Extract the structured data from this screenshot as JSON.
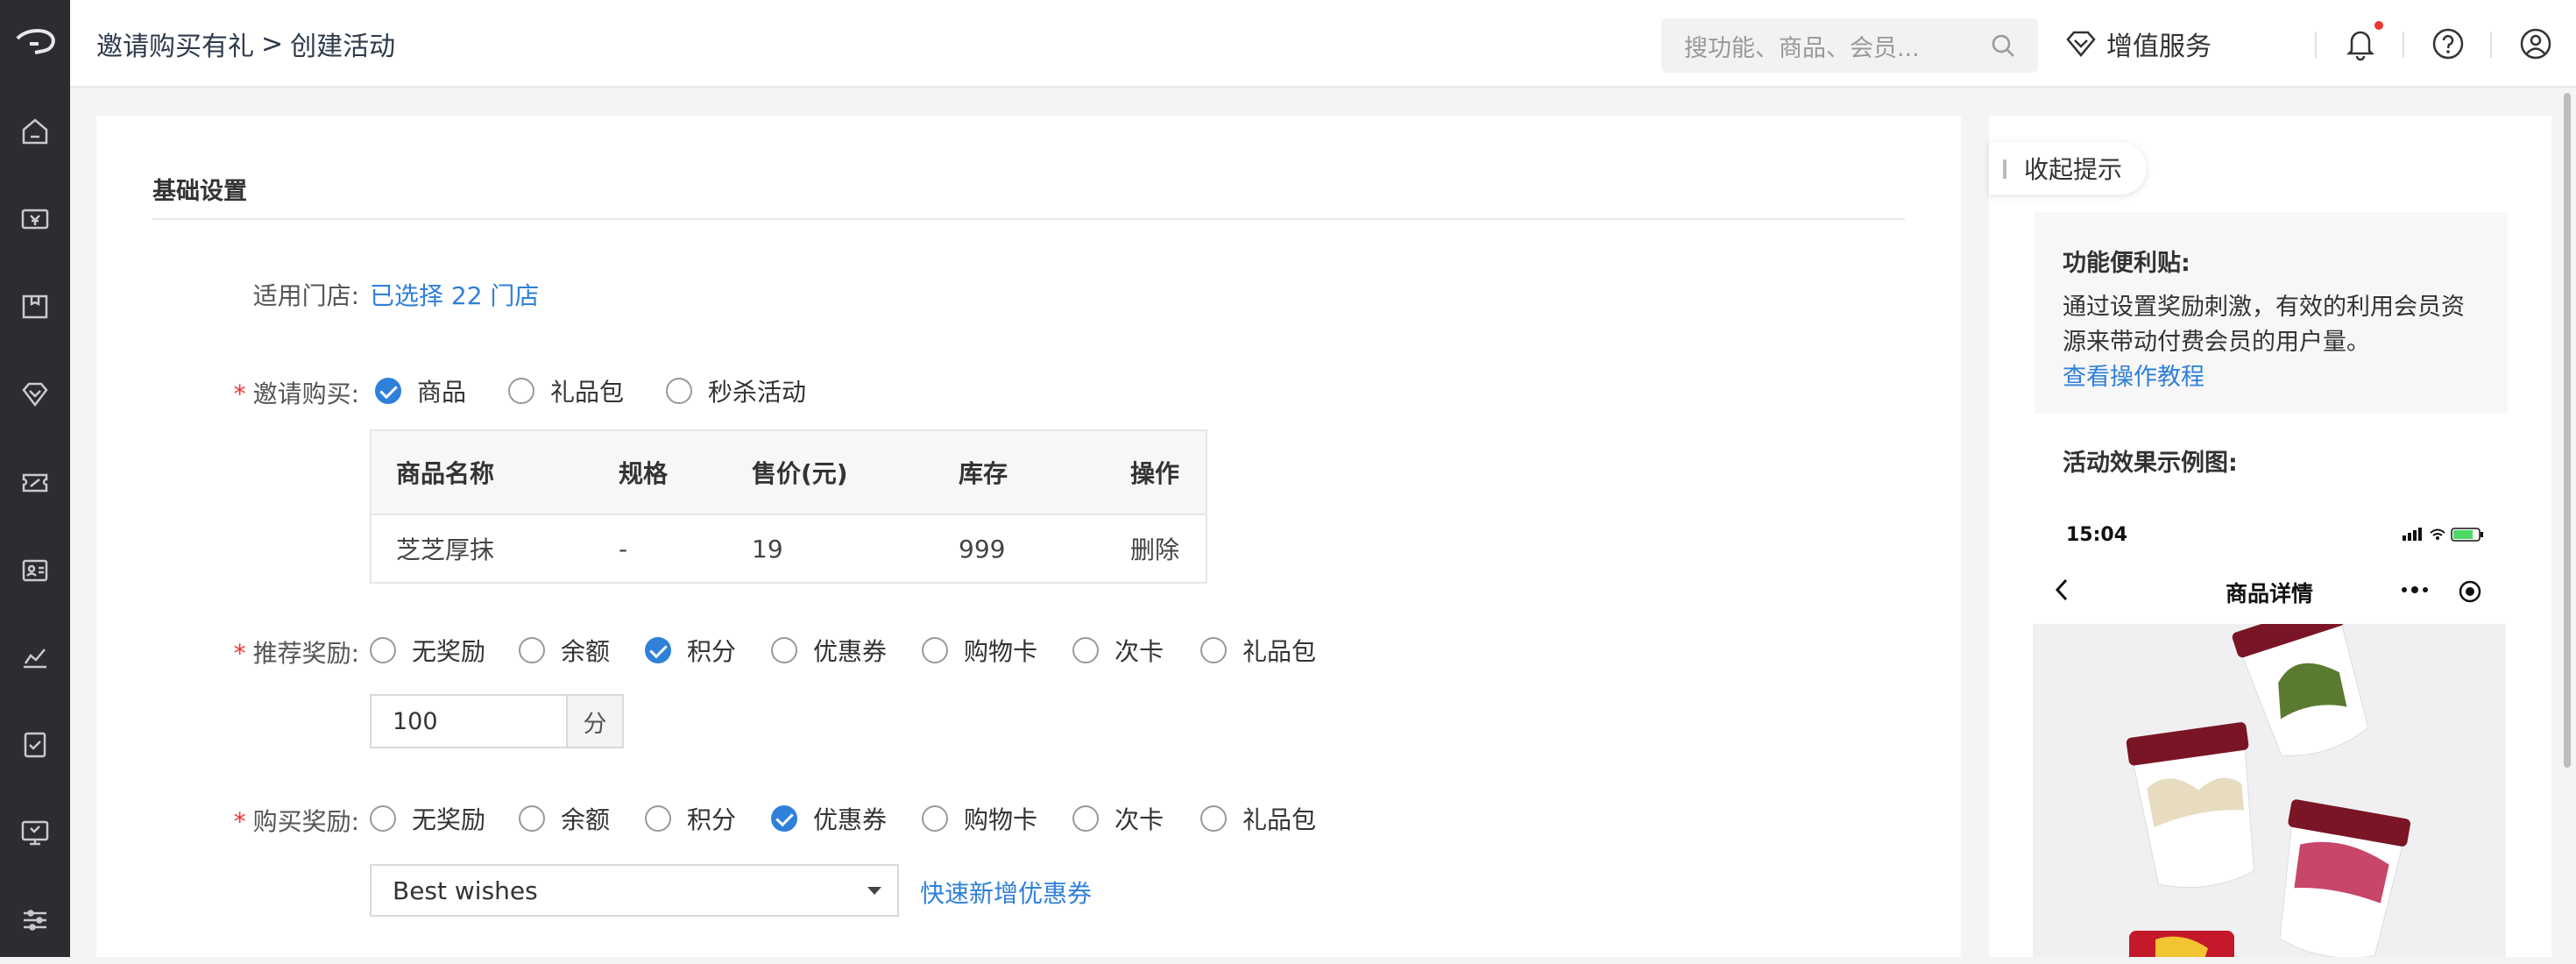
{
  "breadcrumb": {
    "parent": "邀请购买有礼",
    "separator": ">",
    "current": "创建活动"
  },
  "search": {
    "placeholder": "搜功能、商品、会员..."
  },
  "header": {
    "value_added_services": "增值服务"
  },
  "sidebar": {
    "icons": [
      "home-icon",
      "cash-register-icon",
      "package-icon",
      "diamond-icon",
      "coupon-icon",
      "member-card-icon",
      "chart-icon",
      "checklist-icon",
      "monitor-icon",
      "settings-sliders-icon"
    ]
  },
  "form": {
    "section_title": "基础设置",
    "store": {
      "label": "适用门店:",
      "value": "已选择 22 门店"
    },
    "invite": {
      "label": "邀请购买:",
      "options": [
        "商品",
        "礼品包",
        "秒杀活动"
      ],
      "selected": 0
    },
    "product_table": {
      "headers": [
        "商品名称",
        "规格",
        "售价(元)",
        "库存",
        "操作"
      ],
      "rows": [
        {
          "name": "芝芝厚抹",
          "spec": "-",
          "price": "19",
          "stock": "999",
          "action": "删除"
        }
      ]
    },
    "referral_reward": {
      "label": "推荐奖励:",
      "options": [
        "无奖励",
        "余额",
        "积分",
        "优惠券",
        "购物卡",
        "次卡",
        "礼品包"
      ],
      "selected": 2,
      "points_value": "100",
      "points_unit": "分"
    },
    "purchase_reward": {
      "label": "购买奖励:",
      "options": [
        "无奖励",
        "余额",
        "积分",
        "优惠券",
        "购物卡",
        "次卡",
        "礼品包"
      ],
      "selected": 3,
      "coupon_selected": "Best wishes",
      "quick_add": "快速新增优惠券"
    }
  },
  "tips": {
    "collapse": "收起提示",
    "title": "功能便利贴:",
    "text": "通过设置奖励刺激，有效的利用会员资源来带动付费会员的用户量。",
    "link": "查看操作教程",
    "demo_title": "活动效果示例图:",
    "phone": {
      "time": "15:04",
      "title": "商品详情"
    }
  },
  "colors": {
    "accent": "#2f80d9",
    "sidebar": "#2c2d30",
    "required": "#e33333"
  }
}
